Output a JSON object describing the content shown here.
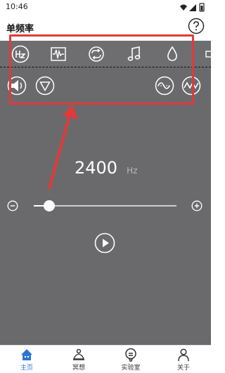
{
  "status_bar": {
    "time": "10:46"
  },
  "header": {
    "title": "单频率",
    "help_icon": "question-circle-icon"
  },
  "mode_icons": [
    {
      "name": "hz-icon",
      "selected": true
    },
    {
      "name": "waveform-icon",
      "selected": false
    },
    {
      "name": "loop-icon",
      "selected": false
    },
    {
      "name": "music-note-icon",
      "selected": false
    },
    {
      "name": "drop-icon",
      "selected": false
    }
  ],
  "frequency": {
    "value": "2400",
    "unit": "Hz"
  },
  "slider": {
    "value_fraction": 0.11
  },
  "bottom_nav": [
    {
      "label": "主页",
      "icon": "home-icon",
      "active": true
    },
    {
      "label": "冥想",
      "icon": "meditation-icon",
      "active": false
    },
    {
      "label": "实验室",
      "icon": "lab-icon",
      "active": false
    },
    {
      "label": "关于",
      "icon": "person-icon",
      "active": false
    }
  ],
  "colors": {
    "accent": "#2a76d2",
    "panel": "#6a6a6c",
    "highlight": "#e03a3a"
  }
}
